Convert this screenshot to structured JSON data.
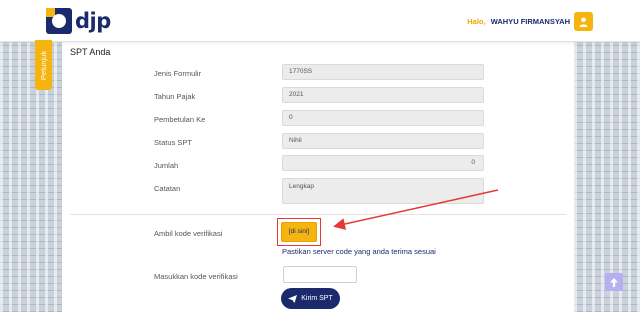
{
  "header": {
    "logo_text": "djp",
    "greeting": "Halo,",
    "user_name": "WAHYU FIRMANSYAH"
  },
  "sidebar_tab": {
    "label": "Petunjuk"
  },
  "card": {
    "title": "SPT Anda",
    "rows": [
      {
        "label": "Jenis Formulir",
        "value": "1770SS"
      },
      {
        "label": "Tahun Pajak",
        "value": "2021"
      },
      {
        "label": "Pembetulan Ke",
        "value": "0"
      },
      {
        "label": "Status SPT",
        "value": "Nihil"
      },
      {
        "label": "Jumlah",
        "value": "0"
      },
      {
        "label": "Catatan",
        "value": "Lengkap"
      }
    ],
    "verification": {
      "label": "Ambil kode verifikasi",
      "button_label": "[di sini]",
      "hint": "Pastikan server code yang anda terima sesuai"
    },
    "code_entry": {
      "label": "Masukkan kode verifikasi",
      "value": "",
      "placeholder": ""
    },
    "submit_label": "Kirim SPT"
  },
  "colors": {
    "brand_navy": "#1a2a6c",
    "brand_yellow": "#f6b40e",
    "annotation_red": "#e53935"
  },
  "icons": {
    "user": "user-icon",
    "send": "paper-plane-icon",
    "scroll_top": "arrow-up-icon"
  }
}
